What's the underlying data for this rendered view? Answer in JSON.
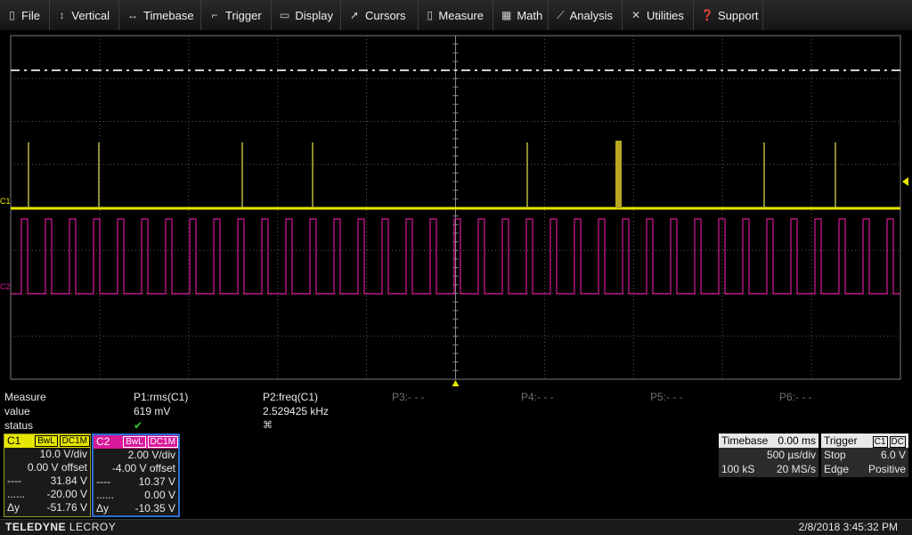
{
  "menu": [
    {
      "label": "File",
      "icon": "file-icon"
    },
    {
      "label": "Vertical",
      "icon": "vertical-arrows-icon"
    },
    {
      "label": "Timebase",
      "icon": "horizontal-arrows-icon"
    },
    {
      "label": "Trigger",
      "icon": "trigger-icon"
    },
    {
      "label": "Display",
      "icon": "display-icon"
    },
    {
      "label": "Cursors",
      "icon": "cursor-icon"
    },
    {
      "label": "Measure",
      "icon": "measure-icon"
    },
    {
      "label": "Math",
      "icon": "calculator-icon"
    },
    {
      "label": "Analysis",
      "icon": "analysis-icon"
    },
    {
      "label": "Utilities",
      "icon": "tools-icon"
    },
    {
      "label": "Support",
      "icon": "question-icon"
    }
  ],
  "grid": {
    "c1_label": "C1",
    "c2_label": "C2",
    "colors": {
      "c1": "#e6e600",
      "c2": "#d8199a",
      "grid": "#5a5a5a",
      "border": "#7a7a7a"
    }
  },
  "measure": {
    "row_labels": [
      "Measure",
      "value",
      "status"
    ],
    "params": [
      {
        "name": "P1:rms(C1)",
        "value": "619 mV",
        "status": "✔"
      },
      {
        "name": "P2:freq(C1)",
        "value": "2.529425 kHz",
        "status": "⌘"
      },
      {
        "name": "P3:- - -",
        "value": "",
        "status": ""
      },
      {
        "name": "P4:- - -",
        "value": "",
        "status": ""
      },
      {
        "name": "P5:- - -",
        "value": "",
        "status": ""
      },
      {
        "name": "P6:- - -",
        "value": "",
        "status": ""
      }
    ]
  },
  "channels": {
    "c1": {
      "name": "C1",
      "tags": [
        "BwL",
        "DC1M"
      ],
      "vdiv": "10.0 V/div",
      "offset": "0.00 V offset",
      "cursor_a_label": "----",
      "cursor_a": "31.84 V",
      "cursor_b_label": "......",
      "cursor_b": "-20.00 V",
      "dy_label": "Δy",
      "dy": "-51.76 V"
    },
    "c2": {
      "name": "C2",
      "tags": [
        "BwL",
        "DC1M"
      ],
      "vdiv": "2.00 V/div",
      "offset": "-4.00 V offset",
      "cursor_a_label": "----",
      "cursor_a": "10.37 V",
      "cursor_b_label": "......",
      "cursor_b": "0.00 V",
      "dy_label": "Δy",
      "dy": "-10.35 V"
    }
  },
  "timebase": {
    "label": "Timebase",
    "delay": "0.00 ms",
    "tdiv": "500 µs/div",
    "samples": "100 kS",
    "rate": "20 MS/s"
  },
  "trigger": {
    "label": "Trigger",
    "src": "C1",
    "coupling": "DC",
    "mode": "Stop",
    "level": "6.0 V",
    "type": "Edge",
    "slope": "Positive"
  },
  "status": {
    "brand_bold": "TELEDYNE",
    "brand_rest": " LECROY",
    "datetime": "2/8/2018 3:45:32 PM"
  }
}
